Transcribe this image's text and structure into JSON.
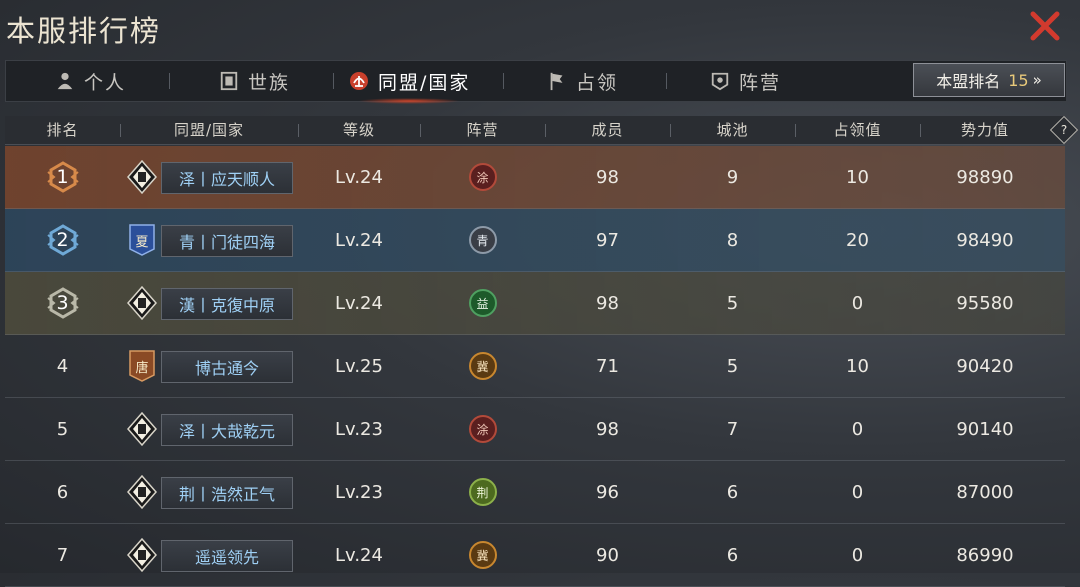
{
  "title": "本服排行榜",
  "tabs": [
    {
      "label": "个人",
      "icon": "person-icon"
    },
    {
      "label": "世族",
      "icon": "clan-icon"
    },
    {
      "label": "同盟/国家",
      "icon": "alliance-icon",
      "active": true
    },
    {
      "label": "占领",
      "icon": "flag-icon"
    },
    {
      "label": "阵营",
      "icon": "camp-icon"
    }
  ],
  "my_rank": {
    "label": "本盟排名",
    "value": "15",
    "chevron": "»"
  },
  "columns": [
    "排名",
    "同盟/国家",
    "等级",
    "阵营",
    "成员",
    "城池",
    "占领值",
    "势力值"
  ],
  "help": "?",
  "rows": [
    {
      "rank": "1",
      "flag": "",
      "name": "泽丨应天顺人",
      "level": "Lv.24",
      "camp": "涂",
      "members": "98",
      "cities": "9",
      "occupy": "10",
      "power": "98890"
    },
    {
      "rank": "2",
      "flag": "夏",
      "name": "青丨门徒四海",
      "level": "Lv.24",
      "camp": "青",
      "members": "97",
      "cities": "8",
      "occupy": "20",
      "power": "98490"
    },
    {
      "rank": "3",
      "flag": "",
      "name": "漢丨克復中原",
      "level": "Lv.24",
      "camp": "益",
      "members": "98",
      "cities": "5",
      "occupy": "0",
      "power": "95580"
    },
    {
      "rank": "4",
      "flag": "唐",
      "name": "博古通今",
      "level": "Lv.25",
      "camp": "冀",
      "members": "71",
      "cities": "5",
      "occupy": "10",
      "power": "90420"
    },
    {
      "rank": "5",
      "flag": "",
      "name": "泽丨大哉乾元",
      "level": "Lv.23",
      "camp": "涂",
      "members": "98",
      "cities": "7",
      "occupy": "0",
      "power": "90140"
    },
    {
      "rank": "6",
      "flag": "",
      "name": "荆丨浩然正气",
      "level": "Lv.23",
      "camp": "荆",
      "members": "96",
      "cities": "6",
      "occupy": "0",
      "power": "87000"
    },
    {
      "rank": "7",
      "flag": "",
      "name": "遥遥领先",
      "level": "Lv.24",
      "camp": "冀",
      "members": "90",
      "cities": "6",
      "occupy": "0",
      "power": "86990"
    }
  ],
  "colors": {
    "accent": "#e8c97a",
    "name_text": "#9fd0f5",
    "close": "#d23a2e"
  }
}
